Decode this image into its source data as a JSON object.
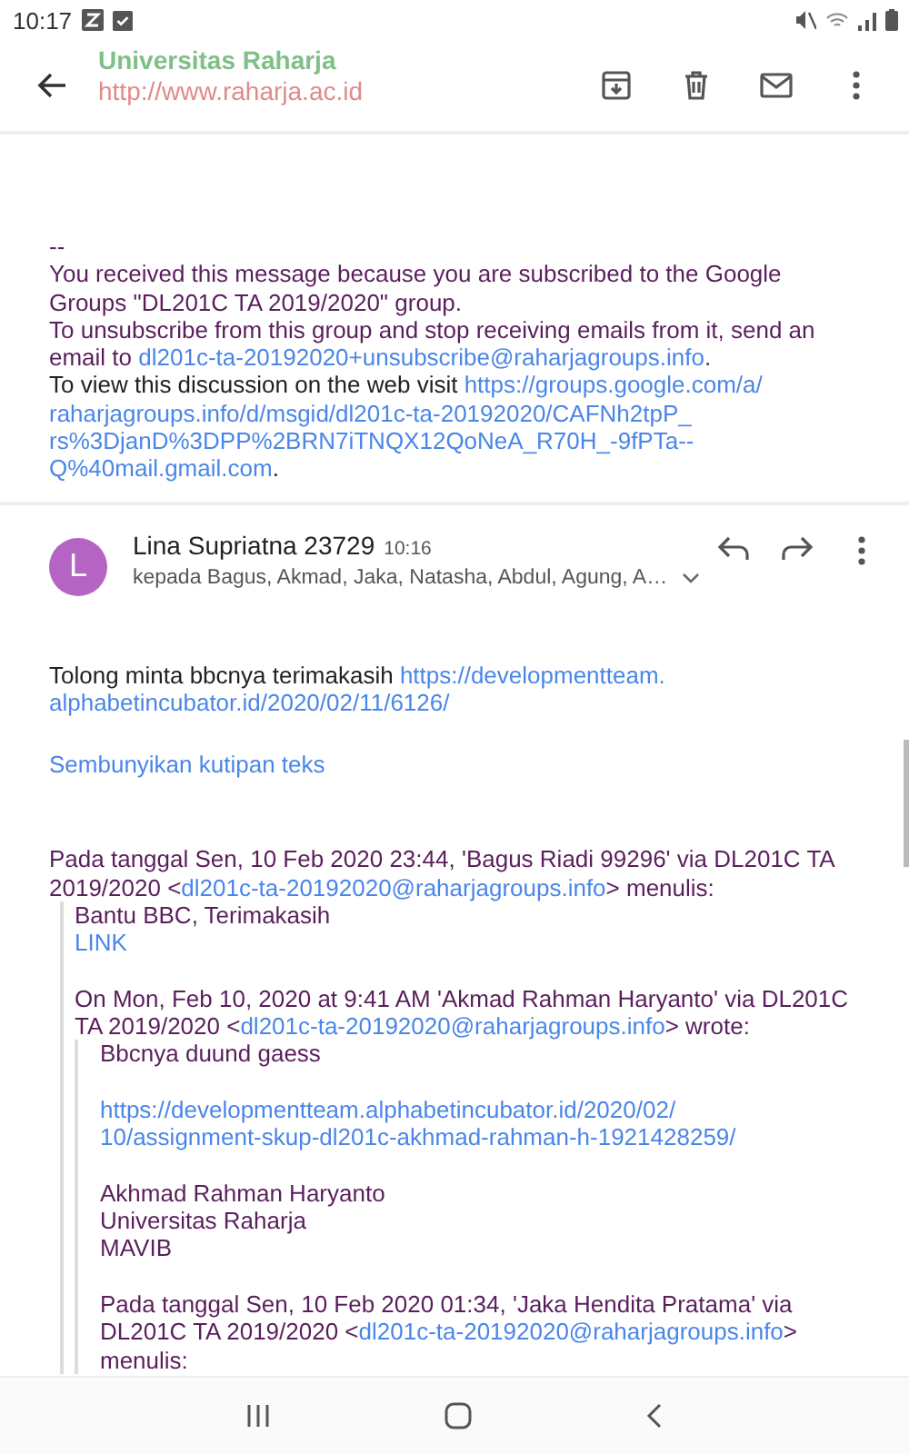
{
  "status_bar": {
    "time": "10:17"
  },
  "toolbar": {
    "faded_title": "Universitas Raharja",
    "faded_url": "http://www.raharja.ac.id"
  },
  "footer": [
    {
      "color": "#5a1e5c",
      "segments": [
        {
          "kind": "text",
          "text": "--"
        }
      ]
    },
    {
      "color": "#5a1e5c",
      "segments": [
        {
          "kind": "text",
          "text": "You received this message because you are subscribed to the Google"
        }
      ]
    },
    {
      "color": "#5a1e5c",
      "segments": [
        {
          "kind": "text",
          "text": "Groups \"DL201C TA 2019/2020\" group."
        }
      ]
    },
    {
      "color": "#5a1e5c",
      "segments": [
        {
          "kind": "text",
          "text": "To unsubscribe from this group and stop receiving emails from it, send an"
        }
      ]
    },
    {
      "color": "#5a1e5c",
      "segments": [
        {
          "kind": "text",
          "text": "email to "
        },
        {
          "kind": "link",
          "text": "dl201c-ta-20192020+unsubscribe@raharjagroups.info"
        },
        {
          "kind": "text",
          "text": "."
        }
      ]
    },
    {
      "color": "#202124",
      "segments": [
        {
          "kind": "text",
          "text": "To view this discussion on the web visit "
        },
        {
          "kind": "link",
          "text": "https://groups.google.com/a/"
        }
      ]
    },
    {
      "segments": [
        {
          "kind": "link",
          "text": "raharjagroups.info/d/msgid/dl201c-ta-20192020/CAFNh2tpP_"
        }
      ]
    },
    {
      "segments": [
        {
          "kind": "link",
          "text": "rs%3DjanD%3DPP%2BRN7iTNQX12QoNeA_R70H_-9fPTa--"
        }
      ]
    },
    {
      "segments": [
        {
          "kind": "link",
          "text": "Q%40mail.gmail.com"
        },
        {
          "kind": "text",
          "text": "."
        }
      ]
    }
  ],
  "message": {
    "avatar_letter": "L",
    "sender": "Lina Supriatna 23729",
    "time": "10:16",
    "recipients": "kepada Bagus, Akmad, Jaka, Natasha, Abdul, Agung, A…",
    "body": [
      {
        "kind": "line",
        "color": "#202124",
        "segments": [
          {
            "kind": "text",
            "text": "Tolong minta  bbcnya  terimakasih "
          },
          {
            "kind": "link",
            "text": "https://developmentteam."
          }
        ]
      },
      {
        "kind": "line",
        "segments": [
          {
            "kind": "link",
            "text": "alphabetincubator.id/2020/02/11/6126/"
          }
        ]
      }
    ],
    "hide_quote": "Sembunyikan kutipan teks",
    "quoted": [
      {
        "kind": "line",
        "color": "#5a1e5c",
        "segments": [
          {
            "kind": "text",
            "text": "Pada tanggal Sen, 10 Feb 2020 23:44, 'Bagus Riadi 99296' via DL201C TA"
          }
        ]
      },
      {
        "kind": "line",
        "color": "#5a1e5c",
        "segments": [
          {
            "kind": "text",
            "text": "2019/2020 <"
          },
          {
            "kind": "link",
            "text": "dl201c-ta-20192020@raharjagroups.info"
          },
          {
            "kind": "text",
            "text": "> menulis:"
          }
        ]
      },
      {
        "kind": "quote",
        "children": [
          {
            "kind": "line",
            "color": "#5a1e5c",
            "segments": [
              {
                "kind": "text",
                "text": "Bantu BBC, Terimakasih"
              }
            ]
          },
          {
            "kind": "line",
            "segments": [
              {
                "kind": "link",
                "text": "LINK"
              }
            ]
          },
          {
            "kind": "gap"
          },
          {
            "kind": "line",
            "color": "#5a1e5c",
            "segments": [
              {
                "kind": "text",
                "text": "On Mon, Feb 10, 2020 at 9:41 AM 'Akmad Rahman Haryanto' via DL201C"
              }
            ]
          },
          {
            "kind": "line",
            "color": "#5a1e5c",
            "segments": [
              {
                "kind": "text",
                "text": "TA 2019/2020 <"
              },
              {
                "kind": "link",
                "text": "dl201c-ta-20192020@raharjagroups.info"
              },
              {
                "kind": "text",
                "text": "> wrote:"
              }
            ]
          },
          {
            "kind": "quote",
            "children": [
              {
                "kind": "line",
                "color": "#5a1e5c",
                "segments": [
                  {
                    "kind": "text",
                    "text": "Bbcnya duund gaess"
                  }
                ]
              },
              {
                "kind": "gap"
              },
              {
                "kind": "line",
                "segments": [
                  {
                    "kind": "link",
                    "text": "https://developmentteam.alphabetincubator.id/2020/02/"
                  }
                ]
              },
              {
                "kind": "line",
                "segments": [
                  {
                    "kind": "link",
                    "text": "10/assignment-skup-dl201c-akhmad-rahman-h-1921428259/"
                  }
                ]
              },
              {
                "kind": "gap"
              },
              {
                "kind": "line",
                "color": "#5a1e5c",
                "segments": [
                  {
                    "kind": "text",
                    "text": "Akhmad Rahman Haryanto"
                  }
                ]
              },
              {
                "kind": "line",
                "color": "#5a1e5c",
                "segments": [
                  {
                    "kind": "text",
                    "text": "Universitas Raharja"
                  }
                ]
              },
              {
                "kind": "line",
                "color": "#5a1e5c",
                "segments": [
                  {
                    "kind": "text",
                    "text": "MAVIB"
                  }
                ]
              },
              {
                "kind": "gap"
              },
              {
                "kind": "line",
                "color": "#5a1e5c",
                "segments": [
                  {
                    "kind": "text",
                    "text": "Pada tanggal Sen, 10 Feb 2020 01:34, 'Jaka Hendita Pratama' via"
                  }
                ]
              },
              {
                "kind": "line",
                "color": "#5a1e5c",
                "segments": [
                  {
                    "kind": "text",
                    "text": "DL201C TA 2019/2020 <"
                  },
                  {
                    "kind": "link",
                    "text": "dl201c-ta-20192020@raharjagroups.info"
                  },
                  {
                    "kind": "text",
                    "text": ">"
                  }
                ]
              },
              {
                "kind": "line",
                "color": "#5a1e5c",
                "segments": [
                  {
                    "kind": "text",
                    "text": "menulis:"
                  }
                ]
              }
            ]
          }
        ]
      }
    ]
  }
}
